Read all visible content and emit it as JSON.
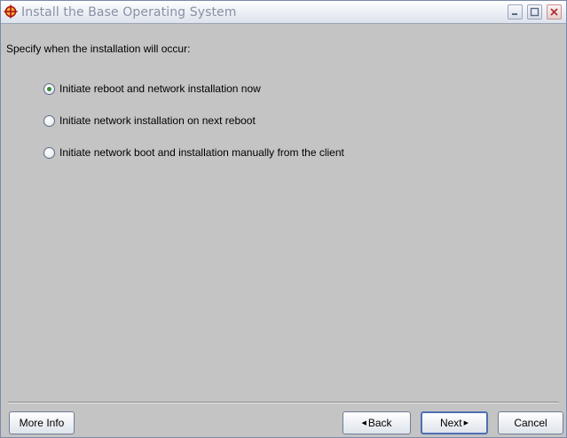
{
  "window": {
    "title": "Install the Base Operating System",
    "icon": "crosshair-icon"
  },
  "prompt": "Specify when the installation will occur:",
  "options": [
    {
      "label": "Initiate reboot and network installation now",
      "selected": true
    },
    {
      "label": "Initiate network installation on next reboot",
      "selected": false
    },
    {
      "label": "Initiate network boot and installation manually from the client",
      "selected": false
    }
  ],
  "buttons": {
    "more_info": "More Info",
    "back": "Back",
    "next": "Next",
    "cancel": "Cancel"
  },
  "colors": {
    "background": "#c4c4c4",
    "title_text": "#8890a4",
    "radio_dot": "#3a8c3a",
    "default_button_border": "#4f6fb3"
  }
}
